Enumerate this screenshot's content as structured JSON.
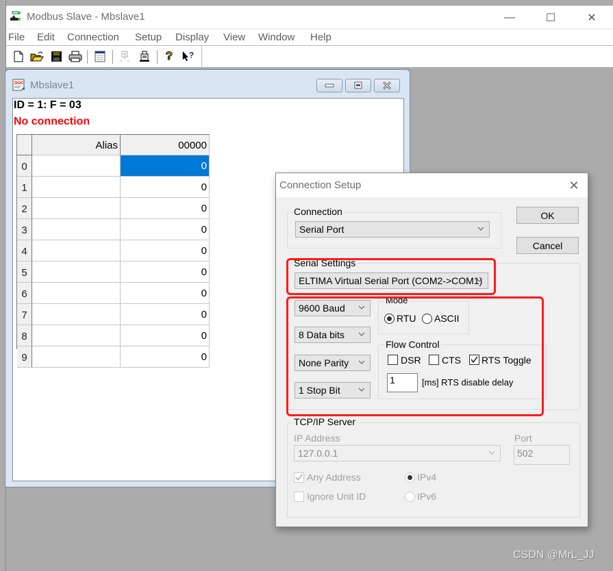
{
  "app": {
    "title": "Modbus Slave - Mbslave1",
    "window_controls": {
      "minimize": "—",
      "maximize": "☐",
      "close": "✕"
    },
    "menu": [
      "File",
      "Edit",
      "Connection",
      "Setup",
      "Display",
      "View",
      "Window",
      "Help"
    ],
    "toolbar": [
      {
        "icon": "new-document-icon"
      },
      {
        "icon": "open-folder-icon"
      },
      {
        "icon": "save-disk-icon"
      },
      {
        "icon": "print-icon"
      },
      {
        "icon": "window-icon"
      },
      {
        "icon": "disconnect-icon"
      },
      {
        "icon": "connect-icon"
      },
      {
        "icon": "help-icon",
        "glyph": "?"
      },
      {
        "icon": "context-help-icon",
        "glyph": "?"
      }
    ]
  },
  "child": {
    "title": "Mbslave1",
    "status_line": "ID = 1: F = 03",
    "connection_status": "No connection",
    "connection_status_color": "#ff0000",
    "grid": {
      "columns": [
        "Alias",
        "00000"
      ],
      "selected_row": 0,
      "rows": [
        {
          "index": "0",
          "alias": "",
          "value": "0"
        },
        {
          "index": "1",
          "alias": "",
          "value": "0"
        },
        {
          "index": "2",
          "alias": "",
          "value": "0"
        },
        {
          "index": "3",
          "alias": "",
          "value": "0"
        },
        {
          "index": "4",
          "alias": "",
          "value": "0"
        },
        {
          "index": "5",
          "alias": "",
          "value": "0"
        },
        {
          "index": "6",
          "alias": "",
          "value": "0"
        },
        {
          "index": "7",
          "alias": "",
          "value": "0"
        },
        {
          "index": "8",
          "alias": "",
          "value": "0"
        },
        {
          "index": "9",
          "alias": "",
          "value": "0"
        }
      ]
    }
  },
  "dialog": {
    "title": "Connection Setup",
    "close": "✕",
    "connection": {
      "label": "Connection",
      "value": "Serial Port"
    },
    "ok_label": "OK",
    "cancel_label": "Cancel",
    "serial_settings": {
      "label": "Serial Settings",
      "port": "ELTIMA Virtual Serial Port (COM2->COM1)",
      "baud": "9600 Baud",
      "data_bits": "8 Data bits",
      "parity": "None Parity",
      "stop_bits": "1 Stop Bit"
    },
    "mode": {
      "label": "Mode",
      "options": [
        {
          "label": "RTU",
          "selected": true
        },
        {
          "label": "ASCII",
          "selected": false
        }
      ]
    },
    "flow_control": {
      "label": "Flow Control",
      "dsr": {
        "label": "DSR",
        "checked": false
      },
      "cts": {
        "label": "CTS",
        "checked": false
      },
      "rts_toggle": {
        "label": "RTS Toggle",
        "checked": true
      },
      "rts_delay_value": "1",
      "rts_delay_label": "[ms] RTS disable delay"
    },
    "tcpip": {
      "label": "TCP/IP Server",
      "ip_label": "IP Address",
      "ip_value": "127.0.0.1",
      "port_label": "Port",
      "port_value": "502",
      "any_address": {
        "label": "Any Address",
        "checked": true
      },
      "ignore_unit_id": {
        "label": "Ignore Unit ID",
        "checked": false
      },
      "ipv4": {
        "label": "IPv4",
        "selected": true
      },
      "ipv6": {
        "label": "IPv6",
        "selected": false
      }
    },
    "highlight_color": "#ff1a1a"
  },
  "watermark": "CSDN @MrL_JJ"
}
